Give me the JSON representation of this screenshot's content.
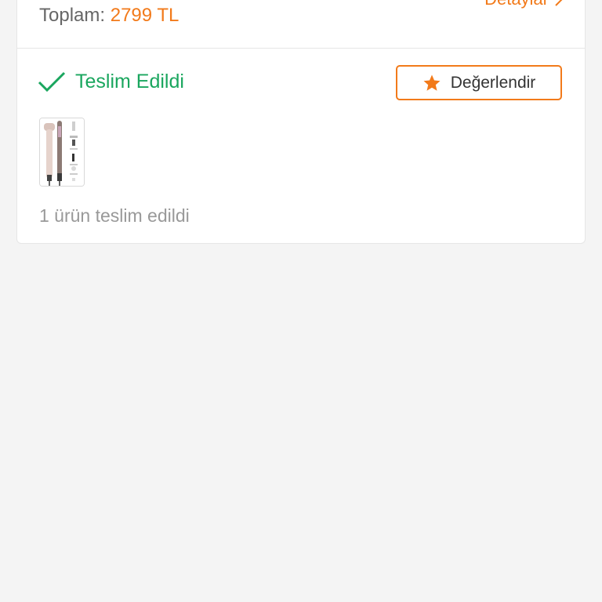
{
  "order": {
    "total_label": "Toplam:",
    "total_amount": "2799 TL",
    "details_label": "Detaylar",
    "status_text": "Teslim Edildi",
    "rate_button_label": "Değerlendir",
    "delivered_note": "1 ürün teslim edildi"
  },
  "colors": {
    "accent": "#f27a1a",
    "success": "#1aa65e",
    "background": "#f4f4f4"
  },
  "icons": {
    "details": "chevron-right-icon",
    "status": "check-icon",
    "rate": "star-icon"
  }
}
